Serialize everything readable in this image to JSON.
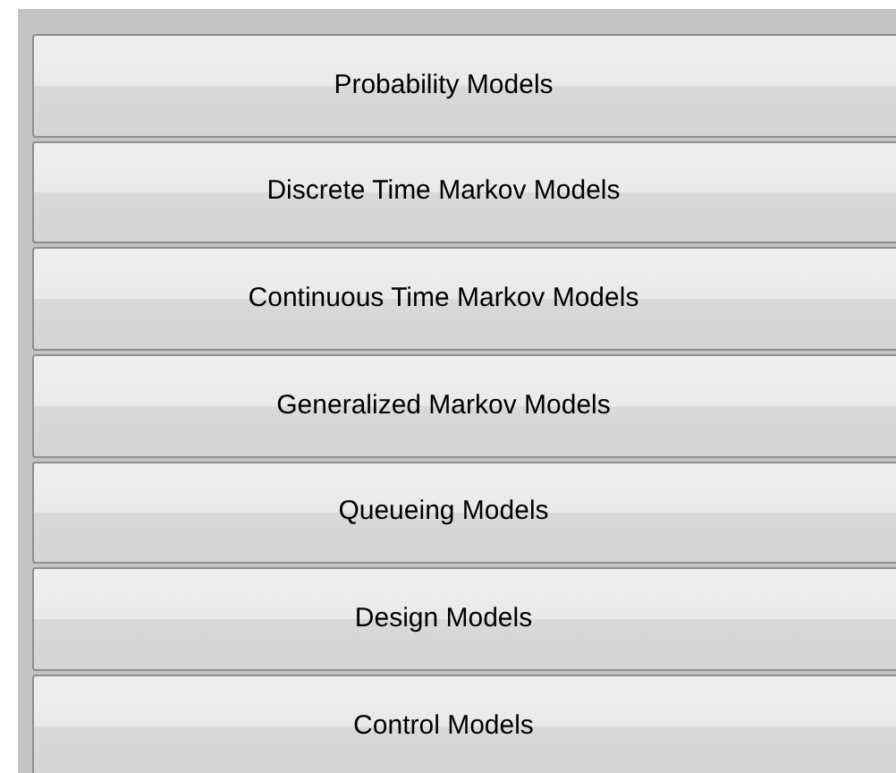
{
  "buttons": [
    {
      "label": "Probability Models"
    },
    {
      "label": "Discrete Time Markov Models"
    },
    {
      "label": "Continuous Time Markov Models"
    },
    {
      "label": "Generalized Markov Models"
    },
    {
      "label": "Queueing Models"
    },
    {
      "label": "Design Models"
    },
    {
      "label": "Control Models"
    }
  ]
}
